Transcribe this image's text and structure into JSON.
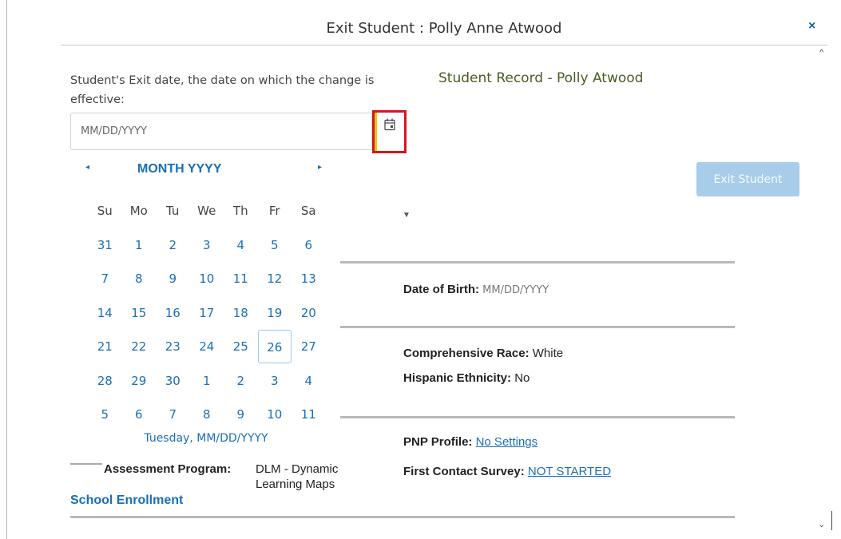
{
  "dialog": {
    "title": "Exit Student : Polly Anne Atwood",
    "close_label": "×",
    "scroll_up": "^",
    "scroll_down": "⌄"
  },
  "exit_form": {
    "date_label": "Student's Exit date, the date on which the change is effective:",
    "date_placeholder": "MM/DD/YYYY",
    "date_value": "",
    "exit_button": "Exit Student"
  },
  "record": {
    "title": "Student Record - Polly Atwood",
    "dob_label": "Date of Birth:",
    "dob_value": "MM/DD/YYYY",
    "race_label": "Comprehensive Race:",
    "race_value": "White",
    "hispanic_label": "Hispanic Ethnicity:",
    "hispanic_value": "No",
    "pnp_label": "PNP Profile:",
    "pnp_value": "No Settings",
    "fcs_label": "First Contact Survey:",
    "fcs_value": "NOT STARTED",
    "assessment_label": "Assessment Program:",
    "assessment_value": "DLM - Dynamic Learning Maps",
    "school_enrollment": "School Enrollment"
  },
  "calendar": {
    "prev": "◂",
    "next": "▸",
    "month": "MONTH YYYY",
    "weekdays": [
      "Su",
      "Mo",
      "Tu",
      "We",
      "Th",
      "Fr",
      "Sa"
    ],
    "weeks": [
      [
        "31",
        "1",
        "2",
        "3",
        "4",
        "5",
        "6"
      ],
      [
        "7",
        "8",
        "9",
        "10",
        "11",
        "12",
        "13"
      ],
      [
        "14",
        "15",
        "16",
        "17",
        "18",
        "19",
        "20"
      ],
      [
        "21",
        "22",
        "23",
        "24",
        "25",
        "26",
        "27"
      ],
      [
        "28",
        "29",
        "30",
        "1",
        "2",
        "3",
        "4"
      ],
      [
        "5",
        "6",
        "7",
        "8",
        "9",
        "10",
        "11"
      ]
    ],
    "today": "26",
    "footer": "Tuesday, MM/DD/YYYY"
  },
  "colors": {
    "accent": "#1a6fb8",
    "highlight_border": "#d0191b",
    "record_title": "#4a5d23",
    "disabled_button": "#a7cdea"
  },
  "icons": {
    "calendar": "calendar-icon",
    "close": "close-icon"
  }
}
